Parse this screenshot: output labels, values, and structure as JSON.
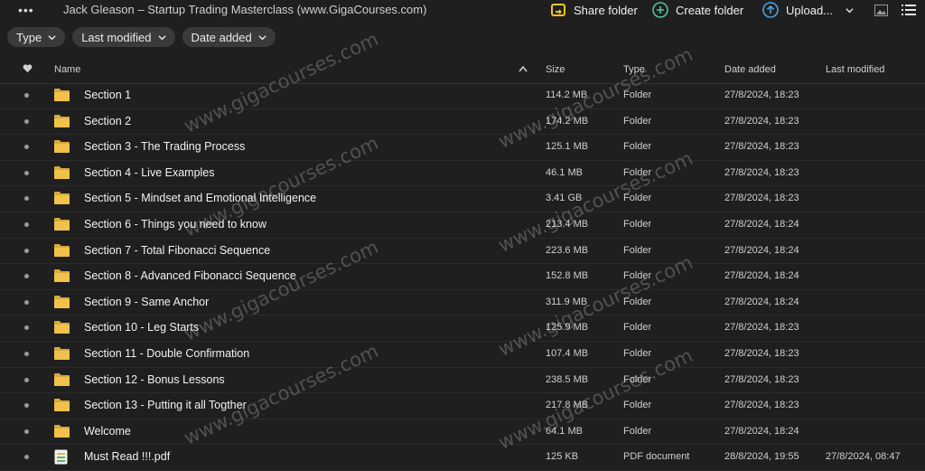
{
  "header": {
    "breadcrumb": "Jack Gleason – Startup Trading Masterclass (www.GigaCourses.com)",
    "more_icon": "more-dots-icon",
    "actions": [
      {
        "label": "Share folder",
        "icon": "share-folder-icon",
        "color": "#f5c518"
      },
      {
        "label": "Create folder",
        "icon": "create-folder-icon",
        "color": "#4fc3a1"
      },
      {
        "label": "Upload...",
        "icon": "upload-icon",
        "color": "#4aa3df"
      }
    ],
    "views": [
      "thumbnail-view-icon",
      "list-view-icon"
    ]
  },
  "filters": [
    {
      "label": "Type"
    },
    {
      "label": "Last modified"
    },
    {
      "label": "Date added"
    }
  ],
  "table": {
    "columns": {
      "favorite": "heart-icon",
      "name": "Name",
      "size": "Size",
      "type": "Type",
      "date_added": "Date added",
      "last_modified": "Last modified"
    },
    "sort": {
      "column": "Name",
      "direction": "ascending"
    },
    "rows": [
      {
        "name": "Section 1",
        "size": "114.2 MB",
        "type": "Folder",
        "date_added": "27/8/2024, 18:23",
        "last_modified": "",
        "icon": "folder-icon"
      },
      {
        "name": "Section 2",
        "size": "174.2 MB",
        "type": "Folder",
        "date_added": "27/8/2024, 18:23",
        "last_modified": "",
        "icon": "folder-icon"
      },
      {
        "name": "Section 3 - The Trading Process",
        "size": "125.1 MB",
        "type": "Folder",
        "date_added": "27/8/2024, 18:23",
        "last_modified": "",
        "icon": "folder-icon"
      },
      {
        "name": "Section 4 - Live Examples",
        "size": "46.1 MB",
        "type": "Folder",
        "date_added": "27/8/2024, 18:23",
        "last_modified": "",
        "icon": "folder-icon"
      },
      {
        "name": "Section 5 - Mindset and Emotional Intelligence",
        "size": "3.41 GB",
        "type": "Folder",
        "date_added": "27/8/2024, 18:23",
        "last_modified": "",
        "icon": "folder-icon"
      },
      {
        "name": "Section 6 - Things you need to know",
        "size": "213.4 MB",
        "type": "Folder",
        "date_added": "27/8/2024, 18:24",
        "last_modified": "",
        "icon": "folder-icon"
      },
      {
        "name": "Section 7 - Total Fibonacci Sequence",
        "size": "223.6 MB",
        "type": "Folder",
        "date_added": "27/8/2024, 18:24",
        "last_modified": "",
        "icon": "folder-icon"
      },
      {
        "name": "Section 8 - Advanced Fibonacci Sequence",
        "size": "152.8 MB",
        "type": "Folder",
        "date_added": "27/8/2024, 18:24",
        "last_modified": "",
        "icon": "folder-icon"
      },
      {
        "name": "Section 9 - Same Anchor",
        "size": "311.9 MB",
        "type": "Folder",
        "date_added": "27/8/2024, 18:24",
        "last_modified": "",
        "icon": "folder-icon"
      },
      {
        "name": "Section 10 - Leg Starts",
        "size": "125.9 MB",
        "type": "Folder",
        "date_added": "27/8/2024, 18:23",
        "last_modified": "",
        "icon": "folder-icon"
      },
      {
        "name": "Section 11 - Double Confirmation",
        "size": "107.4 MB",
        "type": "Folder",
        "date_added": "27/8/2024, 18:23",
        "last_modified": "",
        "icon": "folder-icon"
      },
      {
        "name": "Section 12 - Bonus Lessons",
        "size": "238.5 MB",
        "type": "Folder",
        "date_added": "27/8/2024, 18:23",
        "last_modified": "",
        "icon": "folder-icon"
      },
      {
        "name": "Section 13 - Putting it all Togther",
        "size": "217.8 MB",
        "type": "Folder",
        "date_added": "27/8/2024, 18:23",
        "last_modified": "",
        "icon": "folder-icon"
      },
      {
        "name": "Welcome",
        "size": "64.1 MB",
        "type": "Folder",
        "date_added": "27/8/2024, 18:24",
        "last_modified": "",
        "icon": "folder-icon"
      },
      {
        "name": "Must Read !!!.pdf",
        "size": "125 KB",
        "type": "PDF document",
        "date_added": "28/8/2024, 19:55",
        "last_modified": "27/8/2024, 08:47",
        "icon": "pdf-file-icon"
      }
    ]
  },
  "watermark": "www.gigacourses.com",
  "colors": {
    "background": "#1f1f1f",
    "folder": "#f0c24b",
    "chip": "#3a3a3a"
  }
}
